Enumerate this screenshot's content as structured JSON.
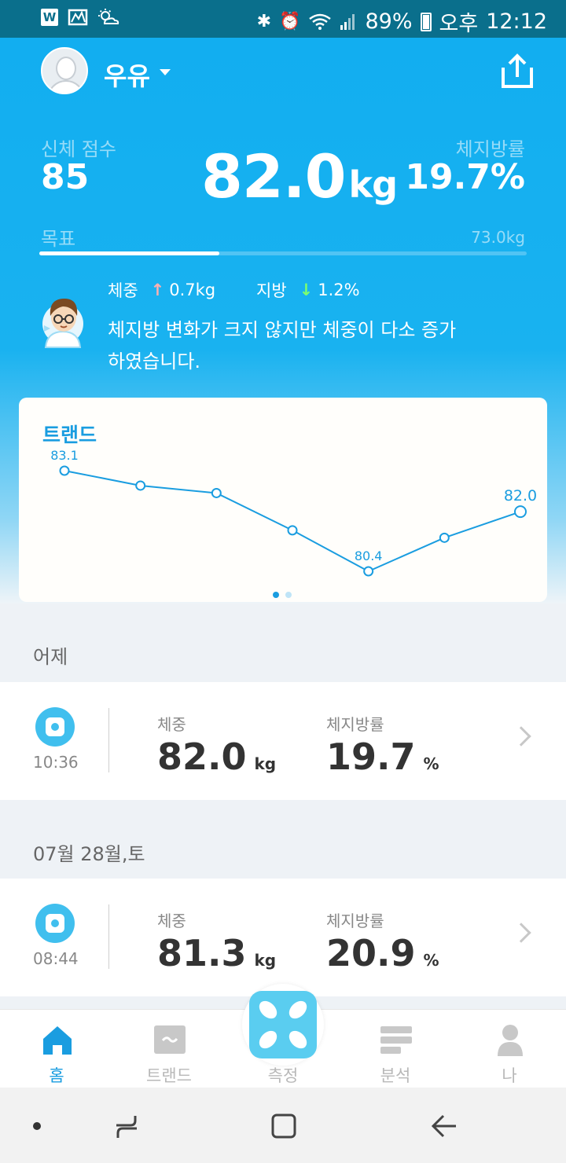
{
  "status_bar": {
    "left_icons": [
      "w-app-icon",
      "gallery-icon",
      "weather-icon"
    ],
    "battery": "89%",
    "ampm": "오후",
    "time": "12:12"
  },
  "header": {
    "user_name": "우유"
  },
  "summary": {
    "score_label": "신체 점수",
    "score_value": "85",
    "weight_value": "82.0",
    "weight_unit": "kg",
    "fat_label": "체지방률",
    "fat_value": "19.7%",
    "goal_label": "목표",
    "goal_value": "73.0kg",
    "goal_progress": 0.37
  },
  "advice": {
    "weight_label": "체중",
    "weight_change": "0.7kg",
    "fat_label": "지방",
    "fat_change": "1.2%",
    "message": "체지방 변화가 크지 않지만 체중이 다소 증가하였습니다."
  },
  "trend": {
    "title": "트랜드"
  },
  "chart_data": {
    "type": "line",
    "title": "트랜드",
    "x": [
      1,
      2,
      3,
      4,
      5,
      6,
      7
    ],
    "series": [
      {
        "values": [
          83.1,
          82.7,
          82.5,
          81.5,
          80.4,
          81.3,
          82.0
        ]
      }
    ],
    "data_labels": [
      {
        "index": 0,
        "text": "83.1"
      },
      {
        "index": 4,
        "text": "80.4"
      },
      {
        "index": 6,
        "text": "82.0"
      }
    ],
    "color": "#1a9de0"
  },
  "records": [
    {
      "date": "어제",
      "time": "10:36",
      "weight_label": "체중",
      "weight_value": "82.0",
      "weight_unit": "kg",
      "fat_label": "체지방률",
      "fat_value": "19.7",
      "fat_unit": "%"
    },
    {
      "date": "07월 28월,토",
      "time": "08:44",
      "weight_label": "체중",
      "weight_value": "81.3",
      "weight_unit": "kg",
      "fat_label": "체지방률",
      "fat_value": "20.9",
      "fat_unit": "%"
    }
  ],
  "bottom_nav": {
    "home": "홈",
    "trend": "트랜드",
    "measure": "측정",
    "analysis": "분석",
    "me": "나"
  },
  "colors": {
    "accent": "#1a9de0",
    "hero": "#12aef0",
    "measure": "#5acdf0"
  }
}
